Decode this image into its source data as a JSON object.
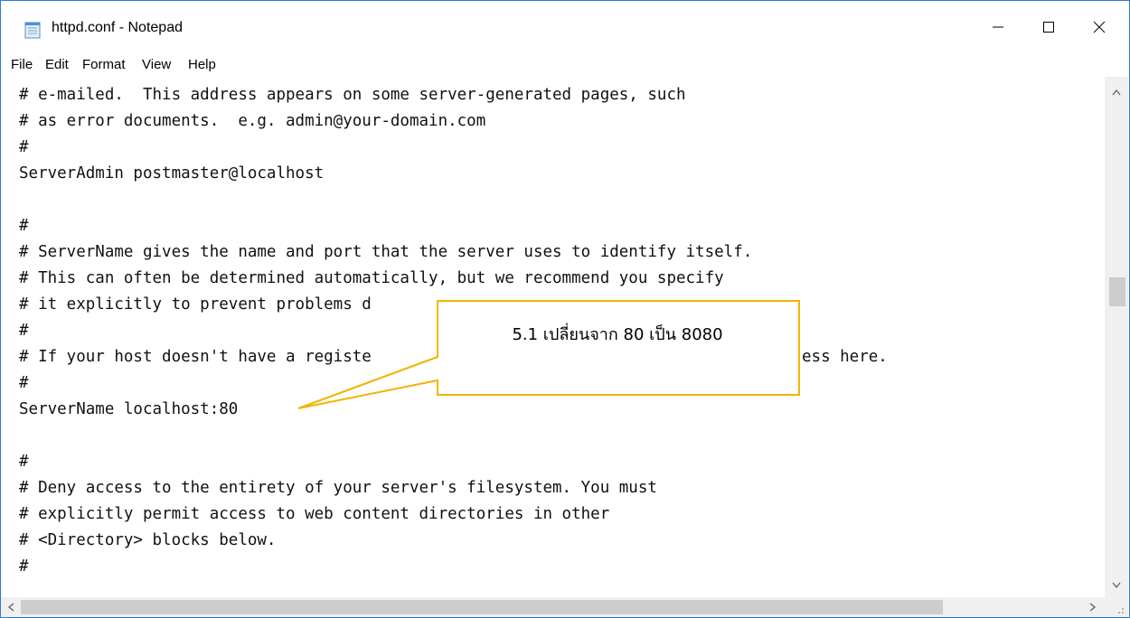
{
  "window": {
    "title": "httpd.conf - Notepad"
  },
  "menu": [
    "File",
    "Edit",
    "Format",
    "View",
    "Help"
  ],
  "editor": {
    "lines": [
      "# e-mailed.  This address appears on some server-generated pages, such",
      "# as error documents.  e.g. admin@your-domain.com",
      "#",
      "ServerAdmin postmaster@localhost",
      "",
      "#",
      "# ServerName gives the name and port that the server uses to identify itself.",
      "# This can often be determined automatically, but we recommend you specify",
      "# it explicitly to prevent problems d",
      "#",
      "# If your host doesn't have a registe",
      "#",
      "ServerName localhost:80",
      "",
      "#",
      "# Deny access to the entirety of your server's filesystem. You must",
      "# explicitly permit access to web content directories in other",
      "# <Directory> blocks below.",
      "#"
    ],
    "partial_right": "ess here."
  },
  "callout": {
    "text": "5.1 เปลี่ยนจาก 80 เป็น 8080",
    "border_color": "#f2b400"
  },
  "icons": [
    "notepad-icon",
    "minimize-icon",
    "maximize-icon",
    "close-icon",
    "scroll-up-icon",
    "scroll-down-icon",
    "scroll-left-icon",
    "scroll-right-icon"
  ]
}
